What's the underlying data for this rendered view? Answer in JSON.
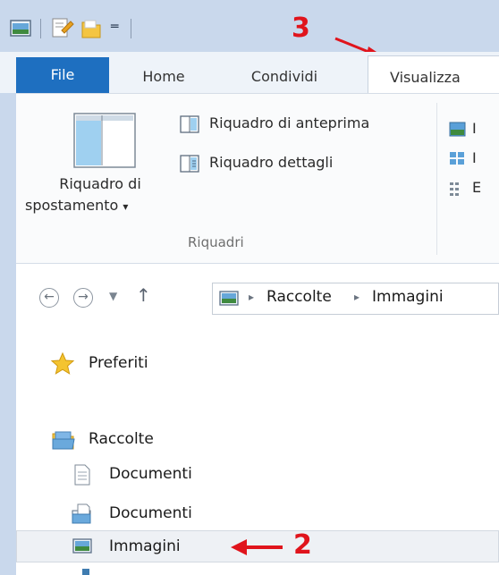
{
  "ribbon": {
    "tabs": {
      "file": "File",
      "home": "Home",
      "share": "Condividi",
      "view": "Visualizza"
    },
    "nav_pane_label_line1": "Riquadro di",
    "nav_pane_label_line2": "spostamento",
    "dropdown_glyph": "▾",
    "preview_pane": "Riquadro di anteprima",
    "details_pane": "Riquadro dettagli",
    "group_label": "Riquadri",
    "clipped_items": [
      "I",
      "I",
      "E"
    ]
  },
  "address": {
    "sep": "▸",
    "crumbs": [
      "Raccolte",
      "Immagini"
    ]
  },
  "nav": {
    "favorites": "Preferiti",
    "libraries": "Raccolte",
    "items": [
      "Documenti",
      "Documenti",
      "Immagini"
    ]
  },
  "annotations": {
    "three": "3",
    "two": "2"
  },
  "colors": {
    "file_tab": "#1e6fc0",
    "annotation": "#e0141c",
    "titlebar": "#c9d8ec"
  }
}
